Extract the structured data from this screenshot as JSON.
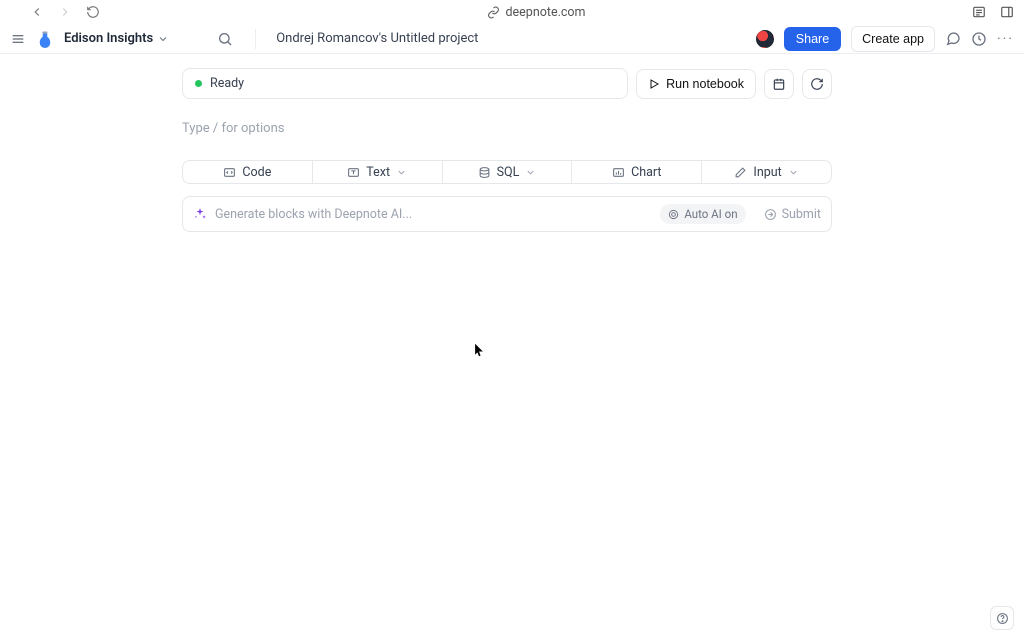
{
  "browser": {
    "url": "deepnote.com"
  },
  "header": {
    "workspace": "Edison Insights",
    "project_title": "Ondrej Romancov's Untitled project",
    "share_label": "Share",
    "create_app_label": "Create app"
  },
  "status": {
    "label": "Ready",
    "run_label": "Run notebook"
  },
  "editor": {
    "placeholder": "Type / for options"
  },
  "block_types": {
    "code": "Code",
    "text": "Text",
    "sql": "SQL",
    "chart": "Chart",
    "input": "Input"
  },
  "ai": {
    "placeholder": "Generate blocks with Deepnote AI...",
    "auto_label": "Auto AI on",
    "submit_label": "Submit"
  }
}
